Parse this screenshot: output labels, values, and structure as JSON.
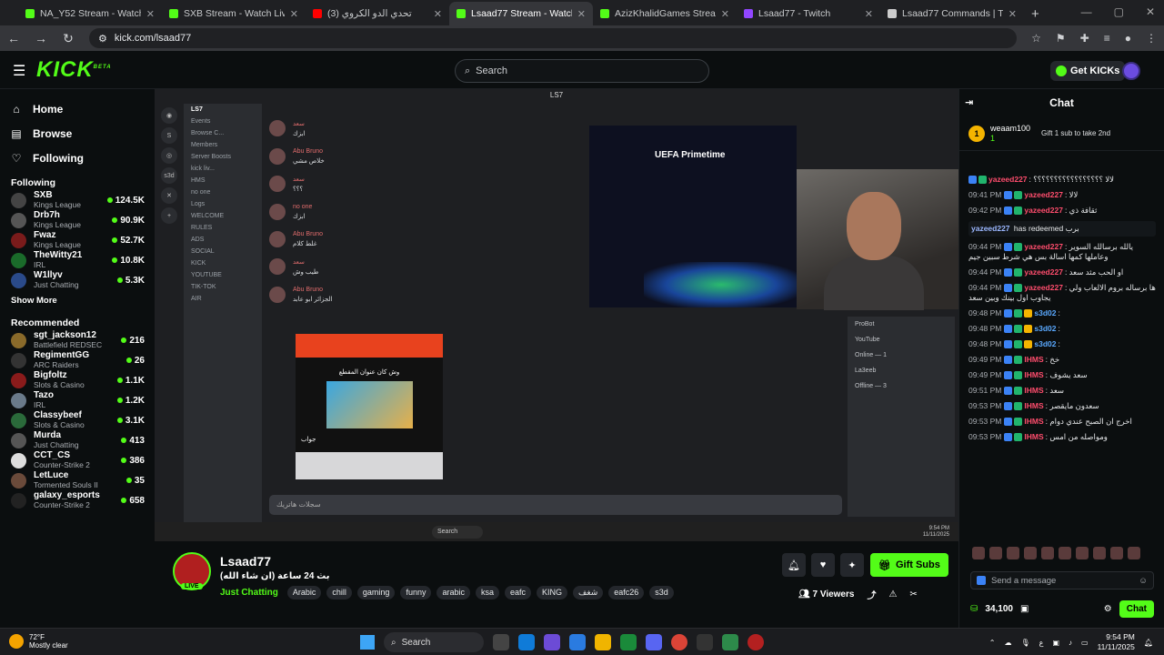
{
  "browser": {
    "tabs": [
      {
        "label": "NA_Y52 Stream - Watch Live on",
        "color": "#53fc18"
      },
      {
        "label": "SXB Stream - Watch Live on Kic",
        "color": "#53fc18"
      },
      {
        "label": "(3) تحدي الدو الكروي",
        "color": "#ff0000"
      },
      {
        "label": "Lsaad77 Stream - Watch Live o",
        "color": "#53fc18"
      },
      {
        "label": "AzizKhalidGames Stream - Wat",
        "color": "#53fc18"
      },
      {
        "label": "Lsaad77 - Twitch",
        "color": "#9146ff"
      },
      {
        "label": "Lsaad77 Commands | The best",
        "color": "#cccccc"
      }
    ],
    "url": "kick.com/lsaad77"
  },
  "header": {
    "logo": "KICK",
    "logo_sup": "BETA",
    "search_placeholder": "Search",
    "get_kicks": "Get KICKs"
  },
  "sidebar": {
    "nav": [
      {
        "label": "Home",
        "icon": "home-icon",
        "glyph": "⌂"
      },
      {
        "label": "Browse",
        "icon": "browse-icon",
        "glyph": "▤"
      },
      {
        "label": "Following",
        "icon": "heart-icon",
        "glyph": "♡"
      }
    ],
    "following_title": "Following",
    "following": [
      {
        "name": "SXB",
        "category": "Kings League",
        "viewers": "124.5K",
        "color": "#444"
      },
      {
        "name": "Drb7h",
        "category": "Kings League",
        "viewers": "90.9K",
        "color": "#555"
      },
      {
        "name": "Fwaz",
        "category": "Kings League",
        "viewers": "52.7K",
        "color": "#7a1b1b"
      },
      {
        "name": "TheWitty21",
        "category": "IRL",
        "viewers": "10.8K",
        "color": "#1a6b2a"
      },
      {
        "name": "W1llyv",
        "category": "Just Chatting",
        "viewers": "5.3K",
        "color": "#2a4a8a"
      }
    ],
    "show_more": "Show More",
    "recommended_title": "Recommended",
    "recommended": [
      {
        "name": "sgt_jackson12",
        "category": "Battlefield REDSEC",
        "viewers": "216",
        "color": "#8a6a2a"
      },
      {
        "name": "RegimentGG",
        "category": "ARC Raiders",
        "viewers": "26",
        "color": "#333"
      },
      {
        "name": "Bigfoltz",
        "category": "Slots & Casino",
        "viewers": "1.1K",
        "color": "#8a1b1b"
      },
      {
        "name": "Tazo",
        "category": "IRL",
        "viewers": "1.2K",
        "color": "#6a7a8a"
      },
      {
        "name": "Classybeef",
        "category": "Slots & Casino",
        "viewers": "3.1K",
        "color": "#2a6a3a"
      },
      {
        "name": "Murda",
        "category": "Just Chatting",
        "viewers": "413",
        "color": "#555"
      },
      {
        "name": "CCT_CS",
        "category": "Counter-Strike 2",
        "viewers": "386",
        "color": "#ddd"
      },
      {
        "name": "LetLuce",
        "category": "Tormented Souls II",
        "viewers": "35",
        "color": "#6a4a3a"
      },
      {
        "name": "galaxy_esports",
        "category": "Counter-Strike 2",
        "viewers": "658",
        "color": "#222"
      }
    ]
  },
  "player": {
    "window_title": "LS7",
    "discord": {
      "channels": [
        "LS7",
        "Events",
        "Browse C...",
        "Members",
        "Server Boosts",
        "kick liv...",
        "HMS",
        "no one",
        "Logs",
        "WELCOME",
        "RULES",
        "ADS",
        "SOCIAL",
        "KICK",
        "YOUTUBE",
        "TIK-TOK",
        "AIR"
      ],
      "messages": [
        {
          "user": "سعد",
          "text": "ابزك"
        },
        {
          "user": "Abu Bruno",
          "text": "خلاص مشي"
        },
        {
          "user": "سعد",
          "text": "؟؟؟"
        },
        {
          "user": "no one",
          "text": "ابزك"
        },
        {
          "user": "Abu Bruno",
          "text": "غلط كلام"
        },
        {
          "user": "سعد",
          "text": "طيب وش"
        },
        {
          "user": "Abu Bruno",
          "text": "الجزائر ابو عابد"
        }
      ],
      "card_title": "وش كان عنوان المقطع",
      "card_answer": "جواب",
      "members": [
        "ProBot",
        "YouTube",
        "Online — 1",
        "La3eeb",
        "Offline — 3"
      ],
      "input_placeholder": "سجلات هاتريك"
    },
    "fifa_title": "UEFA Primetime",
    "windows_taskbar": {
      "search": "Search",
      "time": "9:54 PM",
      "date": "11/11/2025"
    }
  },
  "stream": {
    "name": "Lsaad77",
    "title": "بث 24 ساعة (ان شاء الله)",
    "live_label": "LIVE",
    "category": "Just Chatting",
    "tags": [
      "Arabic",
      "chill",
      "gaming",
      "funny",
      "arabic",
      "ksa",
      "eafc",
      "KING",
      "شغف",
      "eafc26",
      "s3d"
    ],
    "gift_subs": "Gift Subs",
    "viewers": "7 Viewers"
  },
  "chat": {
    "title": "Chat",
    "pinned_user": "weaam100",
    "pinned_count": "1",
    "pinned_gift": "Gift 1 sub to take 2nd",
    "messages": [
      {
        "time": "",
        "user": "yazeed227",
        "color": "#ff4d6d",
        "text": "لالا ؟؟؟؟؟؟؟؟؟؟؟؟؟؟؟؟؟"
      },
      {
        "time": "09:41 PM",
        "user": "yazeed227",
        "color": "#ff4d6d",
        "text": "لالا"
      },
      {
        "time": "09:42 PM",
        "user": "yazeed227",
        "color": "#ff4d6d",
        "text": "ثقافة ذي"
      },
      {
        "time": "",
        "user": "yazeed227",
        "color": "#9bb7ff",
        "text": "has redeemed برب",
        "sys": true
      },
      {
        "time": "09:44 PM",
        "user": "yazeed227",
        "color": "#ff4d6d",
        "text": "يالله برسالله السوير وعاملها كمها اسالة بس هي شرط سبين جيم"
      },
      {
        "time": "09:44 PM",
        "user": "yazeed227",
        "color": "#ff4d6d",
        "text": "او الحب مثد سعد"
      },
      {
        "time": "09:44 PM",
        "user": "yazeed227",
        "color": "#ff4d6d",
        "text": "ها برساله بروم الالعاب ولي يجاوب اول بينك وبين سعد"
      },
      {
        "time": "09:48 PM",
        "user": "s3d02",
        "color": "#5aa9ff",
        "text": ""
      },
      {
        "time": "09:48 PM",
        "user": "s3d02",
        "color": "#5aa9ff",
        "text": ""
      },
      {
        "time": "09:48 PM",
        "user": "s3d02",
        "color": "#5aa9ff",
        "text": ""
      },
      {
        "time": "09:49 PM",
        "user": "IHMS",
        "color": "#ff4d6d",
        "text": "خخ"
      },
      {
        "time": "09:49 PM",
        "user": "IHMS",
        "color": "#ff4d6d",
        "text": "سعد يشوف"
      },
      {
        "time": "09:51 PM",
        "user": "IHMS",
        "color": "#ff4d6d",
        "text": "سعد"
      },
      {
        "time": "09:53 PM",
        "user": "IHMS",
        "color": "#ff4d6d",
        "text": "سعدون مايقصر"
      },
      {
        "time": "09:53 PM",
        "user": "IHMS",
        "color": "#ff4d6d",
        "text": "اخرج ان الصبح عندي دوام"
      },
      {
        "time": "09:53 PM",
        "user": "IHMS",
        "color": "#ff4d6d",
        "text": "ومواصله من امس"
      }
    ],
    "input_placeholder": "Send a message",
    "kicks_balance": "34,100",
    "chat_button": "Chat"
  },
  "taskbar": {
    "temp": "72°F",
    "condition": "Mostly clear",
    "search": "Search",
    "time": "9:54 PM",
    "date": "11/11/2025",
    "lang": "ع"
  }
}
